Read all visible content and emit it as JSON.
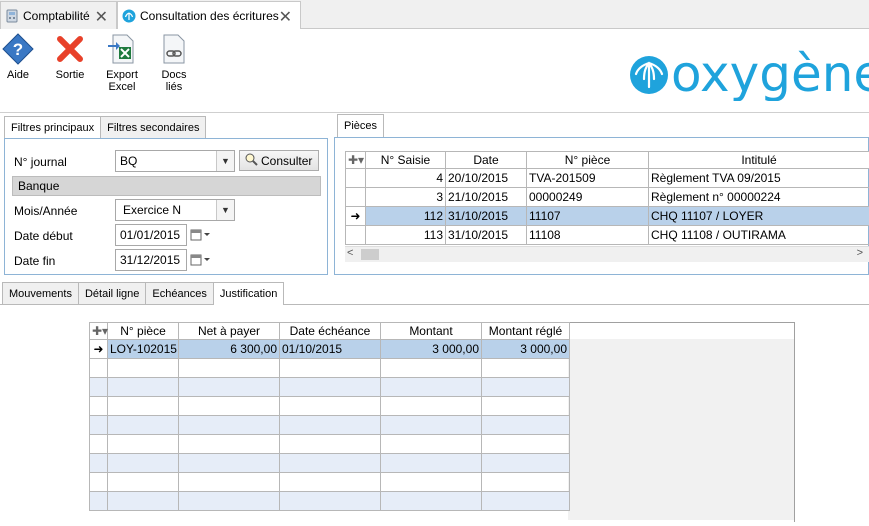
{
  "window_tabs": [
    {
      "label": "Comptabilité"
    },
    {
      "label": "Consultation des écritures"
    }
  ],
  "toolbar": {
    "aide": "Aide",
    "sortie": "Sortie",
    "export_line1": "Export",
    "export_line2": "Excel",
    "docs_line1": "Docs",
    "docs_line2": "liés"
  },
  "logo_text": "oxygène",
  "filter_tabs": [
    "Filtres principaux",
    "Filtres secondaires"
  ],
  "filters": {
    "journal_label": "N° journal",
    "journal_value": "BQ",
    "journal_name": "Banque",
    "consulter": "Consulter",
    "mois_label": "Mois/Année",
    "mois_value": "Exercice N",
    "date_debut_label": "Date début",
    "date_debut_value": "01/01/2015",
    "date_fin_label": "Date fin",
    "date_fin_value": "31/12/2015"
  },
  "pieces": {
    "tab": "Pièces",
    "columns": [
      "N° Saisie",
      "Date",
      "N° pièce",
      "Intitulé"
    ],
    "rows": [
      {
        "saisie": "4",
        "date": "20/10/2015",
        "piece": "TVA-201509",
        "intitule": "Règlement TVA 09/2015"
      },
      {
        "saisie": "3",
        "date": "21/10/2015",
        "piece": "00000249",
        "intitule": "Règlement n° 00000224"
      },
      {
        "saisie": "112",
        "date": "31/10/2015",
        "piece": "11107",
        "intitule": "CHQ 11107 / LOYER"
      },
      {
        "saisie": "113",
        "date": "31/10/2015",
        "piece": "11108",
        "intitule": "CHQ 11108 / OUTIRAMA"
      }
    ],
    "selected_index": 2
  },
  "bottom_tabs": [
    "Mouvements",
    "Détail ligne",
    "Echéances",
    "Justification"
  ],
  "justification": {
    "columns": [
      "N° pièce",
      "Net à payer",
      "Date échéance",
      "Montant",
      "Montant réglé"
    ],
    "rows": [
      {
        "piece": "LOY-102015",
        "net": "6 300,00",
        "date": "01/10/2015",
        "montant": "3 000,00",
        "regle": "3 000,00"
      }
    ]
  },
  "colors": {
    "selected_row": "#b9d1ea",
    "alt_row": "#e6edf8",
    "panel_border": "#8eb4d6",
    "logo_blue": "#1fa3dc",
    "sortie_red": "#e8412a"
  }
}
